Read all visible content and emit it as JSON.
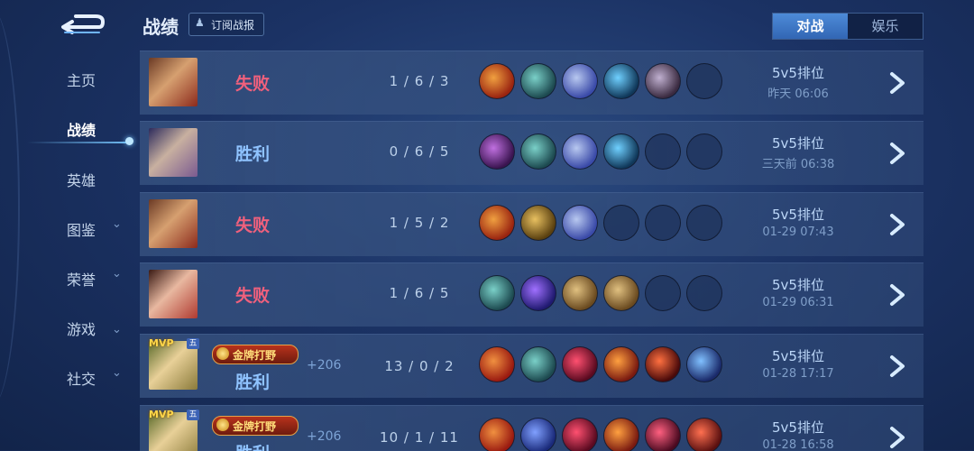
{
  "header": {
    "title": "战绩",
    "subscribe_label": "订阅战报"
  },
  "tabs": [
    {
      "label": "对战"
    },
    {
      "label": "娱乐"
    }
  ],
  "nav": [
    {
      "label": "主页"
    },
    {
      "label": "战绩"
    },
    {
      "label": "英雄"
    },
    {
      "label": "图鉴"
    },
    {
      "label": "荣誉"
    },
    {
      "label": "游戏"
    },
    {
      "label": "社交"
    }
  ],
  "matches": [
    {
      "result": "失败",
      "kda": "1 / 6 / 3",
      "mode": "5v5排位",
      "time": "昨天 06:06"
    },
    {
      "result": "胜利",
      "kda": "0 / 6 / 5",
      "mode": "5v5排位",
      "time": "三天前 06:38"
    },
    {
      "result": "失败",
      "kda": "1 / 5 / 2",
      "mode": "5v5排位",
      "time": "01-29  07:43"
    },
    {
      "result": "失败",
      "kda": "1 / 6 / 5",
      "mode": "5v5排位",
      "time": "01-29  06:31"
    },
    {
      "result": "胜利",
      "kda": "13 / 0 / 2",
      "mode": "5v5排位",
      "time": "01-28  17:17",
      "mvp": "MVP",
      "rank_badge": "五",
      "badge": "金牌打野",
      "points": "+206"
    },
    {
      "result": "胜利",
      "kda": "10 / 1 / 11",
      "mode": "5v5排位",
      "time": "01-28  16:58",
      "mvp": "MVP",
      "rank_badge": "五",
      "badge": "金牌打野",
      "points": "+206"
    }
  ]
}
